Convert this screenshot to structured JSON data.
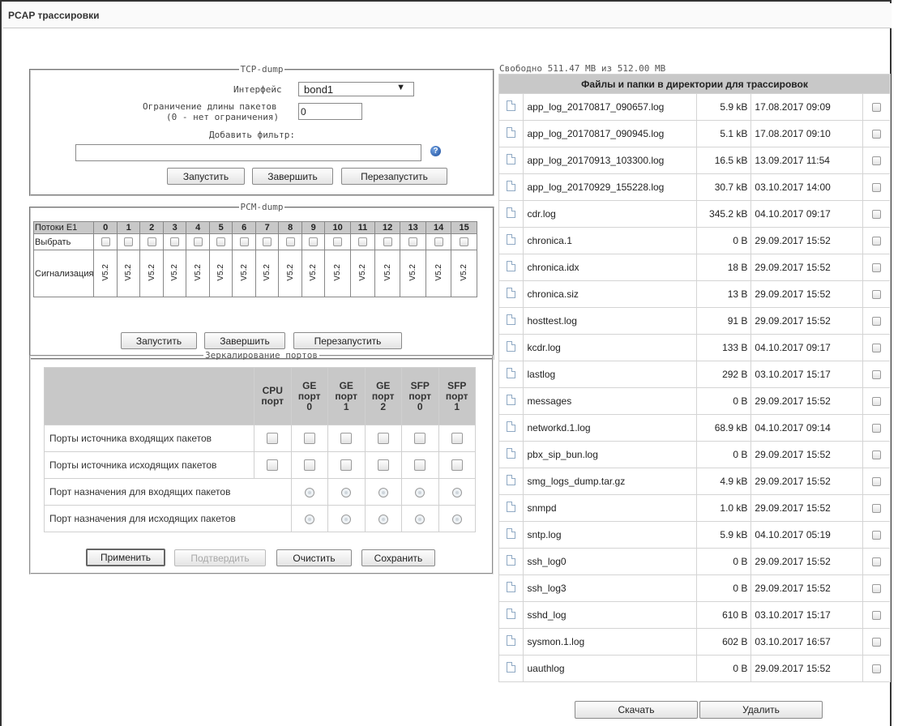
{
  "title": "PCAP трассировки",
  "tcpdump": {
    "legend": "TCP-dump",
    "interface_label": "Интерфейс",
    "interface_value": "bond1",
    "pkt_limit_label_1": "Ограничение длины пакетов",
    "pkt_limit_label_2": "(0 - нет ограничения)",
    "pkt_limit_value": "0",
    "filter_label": "Добавить фильтр:",
    "filter_value": "",
    "help_icon": "question-icon",
    "start": "Запустить",
    "stop": "Завершить",
    "restart": "Перезапустить"
  },
  "pcmdump": {
    "legend": "PCM-dump",
    "header_label": "Потоки E1",
    "streams": [
      "0",
      "1",
      "2",
      "3",
      "4",
      "5",
      "6",
      "7",
      "8",
      "9",
      "10",
      "11",
      "12",
      "13",
      "14",
      "15"
    ],
    "select_label": "Выбрать",
    "signal_label": "Сигнализация",
    "signal_values": [
      "V5.2",
      "V5.2",
      "V5.2",
      "V5.2",
      "V5.2",
      "V5.2",
      "V5.2",
      "V5.2",
      "V5.2",
      "V5.2",
      "V5.2",
      "V5.2",
      "V5.2",
      "V5.2",
      "V5.2",
      "V5.2"
    ],
    "start": "Запустить",
    "stop": "Завершить",
    "restart": "Перезапустить"
  },
  "mirror": {
    "legend": "Зеркалирование портов",
    "columns": [
      {
        "l1": "CPU",
        "l2": "порт",
        "l3": ""
      },
      {
        "l1": "GE",
        "l2": "порт",
        "l3": "0"
      },
      {
        "l1": "GE",
        "l2": "порт",
        "l3": "1"
      },
      {
        "l1": "GE",
        "l2": "порт",
        "l3": "2"
      },
      {
        "l1": "SFP",
        "l2": "порт",
        "l3": "0"
      },
      {
        "l1": "SFP",
        "l2": "порт",
        "l3": "1"
      }
    ],
    "rows": [
      "Порты источника входящих пакетов",
      "Порты источника исходящих пакетов",
      "Порт назначения для входящих пакетов",
      "Порт назначения для исходящих пакетов"
    ],
    "apply": "Применить",
    "confirm": "Подтвердить",
    "clear": "Очистить",
    "save": "Сохранить"
  },
  "files": {
    "free_space": "Свободно 511.47 MB из 512.00 MB",
    "header": "Файлы и папки в директории для трассировок",
    "items": [
      {
        "name": "app_log_20170817_090657.log",
        "size": "5.9 kB",
        "date": "17.08.2017 09:09"
      },
      {
        "name": "app_log_20170817_090945.log",
        "size": "5.1 kB",
        "date": "17.08.2017 09:10"
      },
      {
        "name": "app_log_20170913_103300.log",
        "size": "16.5 kB",
        "date": "13.09.2017 11:54"
      },
      {
        "name": "app_log_20170929_155228.log",
        "size": "30.7 kB",
        "date": "03.10.2017 14:00"
      },
      {
        "name": "cdr.log",
        "size": "345.2 kB",
        "date": "04.10.2017 09:17"
      },
      {
        "name": "chronica.1",
        "size": "0 B",
        "date": "29.09.2017 15:52"
      },
      {
        "name": "chronica.idx",
        "size": "18 B",
        "date": "29.09.2017 15:52"
      },
      {
        "name": "chronica.siz",
        "size": "13 B",
        "date": "29.09.2017 15:52"
      },
      {
        "name": "hosttest.log",
        "size": "91 B",
        "date": "29.09.2017 15:52"
      },
      {
        "name": "kcdr.log",
        "size": "133 B",
        "date": "04.10.2017 09:17"
      },
      {
        "name": "lastlog",
        "size": "292 B",
        "date": "03.10.2017 15:17"
      },
      {
        "name": "messages",
        "size": "0 B",
        "date": "29.09.2017 15:52"
      },
      {
        "name": "networkd.1.log",
        "size": "68.9 kB",
        "date": "04.10.2017 09:14"
      },
      {
        "name": "pbx_sip_bun.log",
        "size": "0 B",
        "date": "29.09.2017 15:52"
      },
      {
        "name": "smg_logs_dump.tar.gz",
        "size": "4.9 kB",
        "date": "29.09.2017 15:52"
      },
      {
        "name": "snmpd",
        "size": "1.0 kB",
        "date": "29.09.2017 15:52"
      },
      {
        "name": "sntp.log",
        "size": "5.9 kB",
        "date": "04.10.2017 05:19"
      },
      {
        "name": "ssh_log0",
        "size": "0 B",
        "date": "29.09.2017 15:52"
      },
      {
        "name": "ssh_log3",
        "size": "0 B",
        "date": "29.09.2017 15:52"
      },
      {
        "name": "sshd_log",
        "size": "610 B",
        "date": "03.10.2017 15:17"
      },
      {
        "name": "sysmon.1.log",
        "size": "602 B",
        "date": "03.10.2017 16:57"
      },
      {
        "name": "uauthlog",
        "size": "0 B",
        "date": "29.09.2017 15:52"
      }
    ],
    "download": "Скачать",
    "delete": "Удалить"
  }
}
